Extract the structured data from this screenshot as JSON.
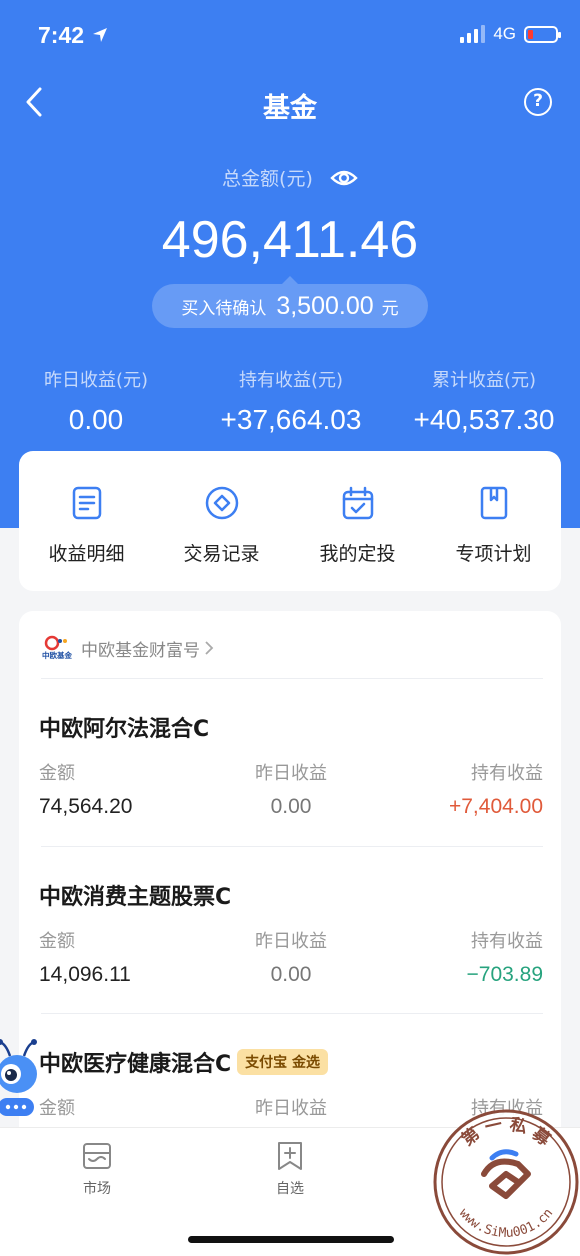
{
  "status": {
    "time": "7:42",
    "network": "4G"
  },
  "nav": {
    "title": "基金",
    "help_glyph": "?"
  },
  "summary": {
    "total_label": "总金额(元)",
    "total_value": "496,411.46",
    "pending_label": "买入待确认",
    "pending_amount": "3,500.00",
    "pending_unit": "元"
  },
  "stats": [
    {
      "label": "昨日收益(元)",
      "value": "0.00"
    },
    {
      "label": "持有收益(元)",
      "value": "+37,664.03"
    },
    {
      "label": "累计收益(元)",
      "value": "+40,537.30"
    }
  ],
  "actions": [
    {
      "label": "收益明细",
      "icon": "document-icon"
    },
    {
      "label": "交易记录",
      "icon": "diamond-circle-icon"
    },
    {
      "label": "我的定投",
      "icon": "calendar-check-icon"
    },
    {
      "label": "专项计划",
      "icon": "bookmark-book-icon"
    }
  ],
  "brand": {
    "name": "中欧基金财富号",
    "logo_text": "中欧基金"
  },
  "columns": {
    "amount": "金额",
    "yesterday": "昨日收益",
    "holding": "持有收益"
  },
  "funds": [
    {
      "name": "中欧阿尔法混合C",
      "amount": "74,564.20",
      "yesterday": "0.00",
      "holding": "+7,404.00",
      "trend": "up"
    },
    {
      "name": "中欧消费主题股票C",
      "amount": "14,096.11",
      "yesterday": "0.00",
      "holding": "−703.89",
      "trend": "down"
    },
    {
      "name": "中欧医疗健康混合C",
      "badge": "支付宝 金选"
    }
  ],
  "tabs": [
    {
      "label": "市场",
      "icon": "market-icon"
    },
    {
      "label": "自选",
      "icon": "watchlist-add-icon"
    }
  ],
  "watermark": {
    "top_text": "第 一 私 募",
    "bottom_text": "www.SiMu001.cn"
  },
  "colors": {
    "primary": "#3d7ff2",
    "gain": "#e05a3a",
    "loss": "#27a37e",
    "badge_bg": "#fbe0a3"
  }
}
